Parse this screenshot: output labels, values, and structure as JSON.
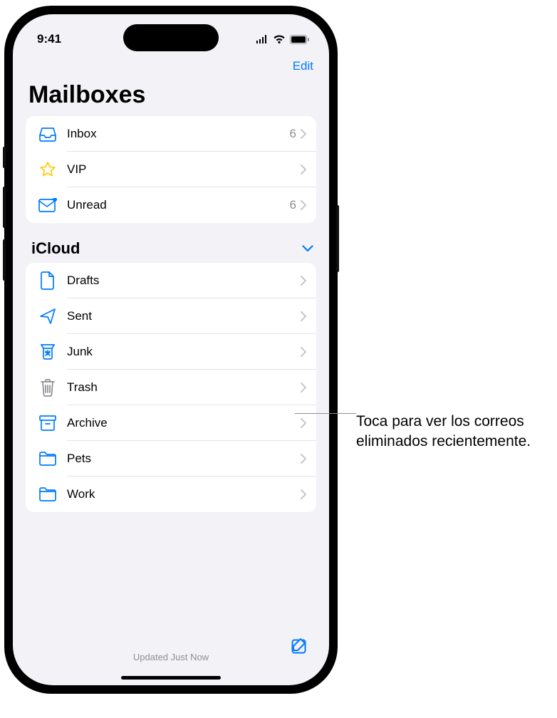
{
  "status": {
    "time": "9:41"
  },
  "nav": {
    "edit": "Edit"
  },
  "title": "Mailboxes",
  "smart": [
    {
      "icon": "inbox",
      "label": "Inbox",
      "count": "6"
    },
    {
      "icon": "star",
      "label": "VIP",
      "count": ""
    },
    {
      "icon": "unread",
      "label": "Unread",
      "count": "6"
    }
  ],
  "section": "iCloud",
  "folders": [
    {
      "icon": "draft",
      "label": "Drafts"
    },
    {
      "icon": "sent",
      "label": "Sent"
    },
    {
      "icon": "junk",
      "label": "Junk"
    },
    {
      "icon": "trash",
      "label": "Trash"
    },
    {
      "icon": "archive",
      "label": "Archive"
    },
    {
      "icon": "folder",
      "label": "Pets"
    },
    {
      "icon": "folder",
      "label": "Work"
    }
  ],
  "footer": {
    "status": "Updated Just Now"
  },
  "callout": "Toca para ver los correos eliminados recientemente."
}
